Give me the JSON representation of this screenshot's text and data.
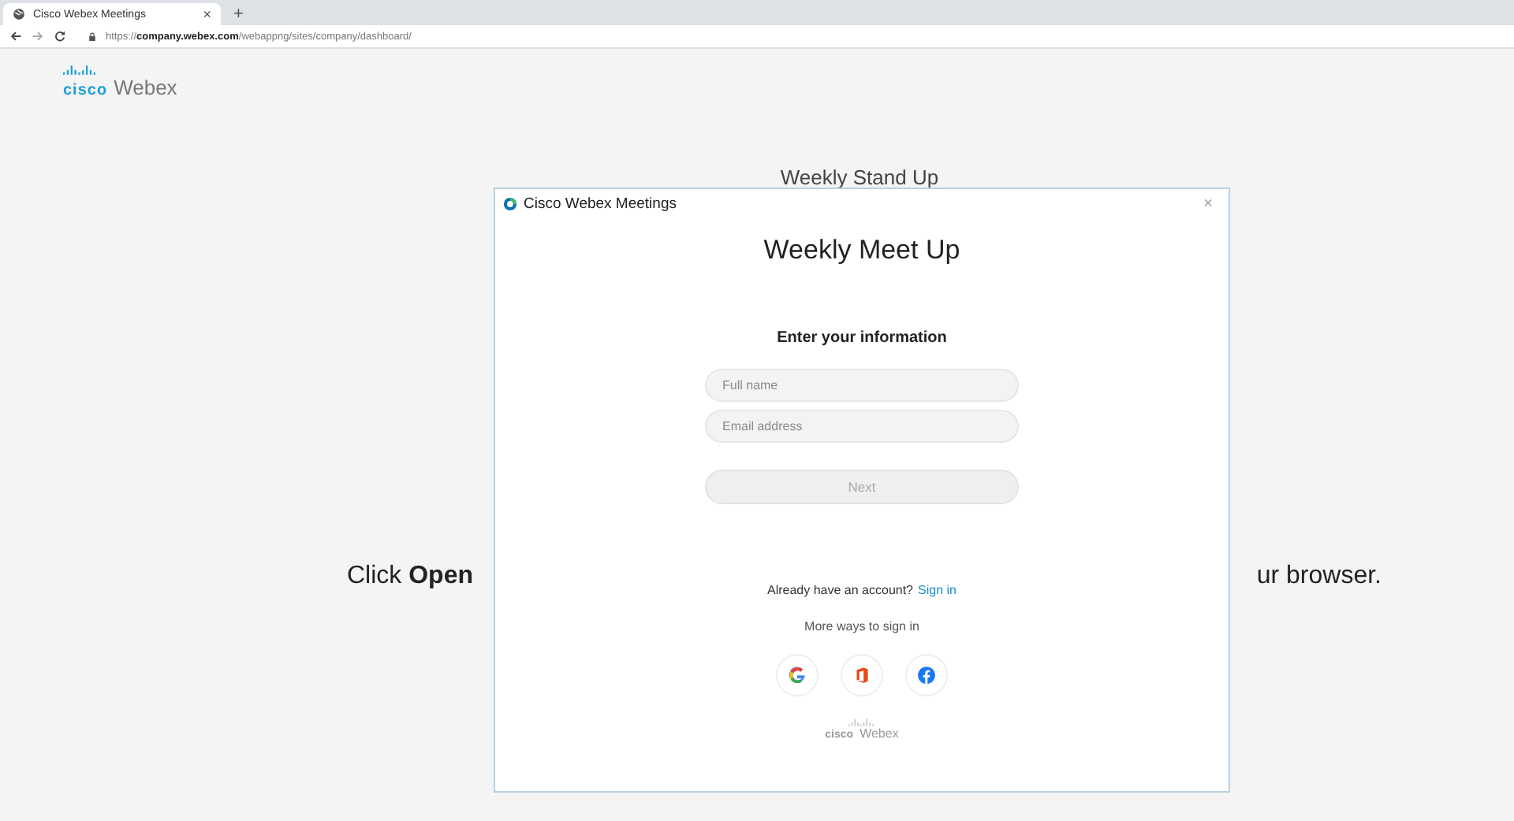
{
  "browser": {
    "tab": {
      "title": "Cisco Webex Meetings",
      "close": "×",
      "selected": true
    },
    "new_tab": "+",
    "url": "https://**company.webex.com**/webappng/sites/company/dashboard/"
  },
  "page": {
    "logo": {
      "brand": "cisco",
      "product": "Webex"
    },
    "meeting_title": "Weekly Stand Up",
    "instruction_left": "Click **Open**",
    "instruction_right": "ur browser."
  },
  "dialog": {
    "title": "Cisco Webex Meetings",
    "close": "×",
    "heading": "Weekly Meet Up",
    "subheading": "Enter your information",
    "fields": [
      {
        "placeholder": "Full name"
      },
      {
        "placeholder": "Email address"
      }
    ],
    "next_button": {
      "label": "Next",
      "disabled": true
    },
    "account_prompt": "Already have an account?",
    "sign_in_link": "Sign in",
    "more_ways": "More ways to sign in",
    "providers": [
      {
        "kind": "google"
      },
      {
        "kind": "office"
      },
      {
        "kind": "facebook"
      }
    ],
    "footer_logo": {
      "brand": "cisco",
      "product": "Webex"
    }
  }
}
